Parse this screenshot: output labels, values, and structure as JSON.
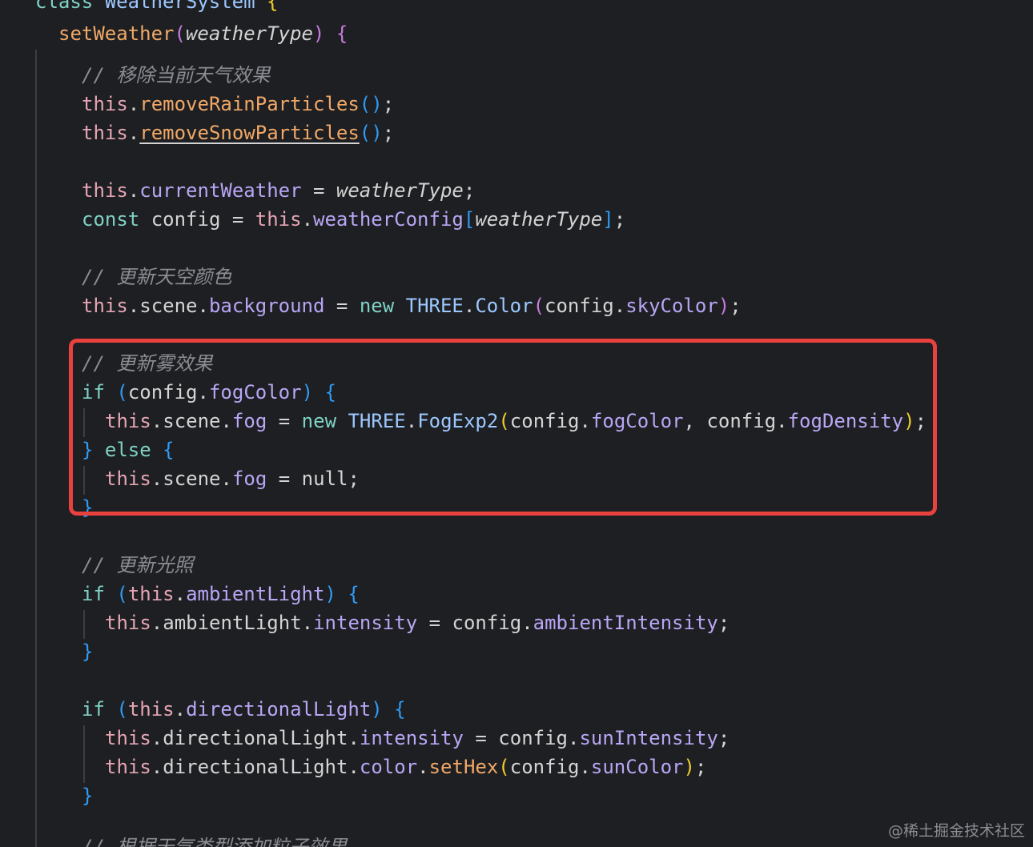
{
  "code": {
    "class_keyword": "class",
    "class_name": "WeatherSystem",
    "method_name": "setWeather",
    "param_name": "weatherType",
    "comment_remove": "// 移除当前天气效果",
    "remove_rain": "removeRainParticles",
    "remove_snow": "removeSnowParticles",
    "current_weather": "currentWeather",
    "weather_config": "weatherConfig",
    "comment_sky": "// 更新天空颜色",
    "scene": "scene",
    "background": "background",
    "three": "THREE",
    "color_cls": "Color",
    "config": "config",
    "sky_color": "skyColor",
    "comment_fog": "// 更新雾效果",
    "fog_color": "fogColor",
    "fog": "fog",
    "fog_exp2": "FogExp2",
    "fog_density": "fogDensity",
    "null_kw": "null",
    "comment_light": "// 更新光照",
    "ambient_light": "ambientLight",
    "intensity": "intensity",
    "ambient_intensity": "ambientIntensity",
    "directional_light": "directionalLight",
    "sun_intensity": "sunIntensity",
    "color_prop": "color",
    "set_hex": "setHex",
    "sun_color": "sunColor",
    "comment_partial": "// 根据天气类型添加粒子效果",
    "kw_this": "this",
    "kw_const": "const",
    "kw_new": "new",
    "kw_if": "if",
    "kw_else": "else"
  },
  "watermark": "@稀土掘金技术社区",
  "colors": {
    "background": "#1e1f22",
    "highlight_border": "#e8413e",
    "this_keyword": "#e6a5b4",
    "method": "#f0a868",
    "property": "#b9a6f5",
    "keyword": "#7fd1c6",
    "comment": "#8a8d93",
    "bracket_blue": "#2f9bf5",
    "bracket_purple": "#c67be0",
    "bracket_yellow": "#f2cc2c"
  }
}
